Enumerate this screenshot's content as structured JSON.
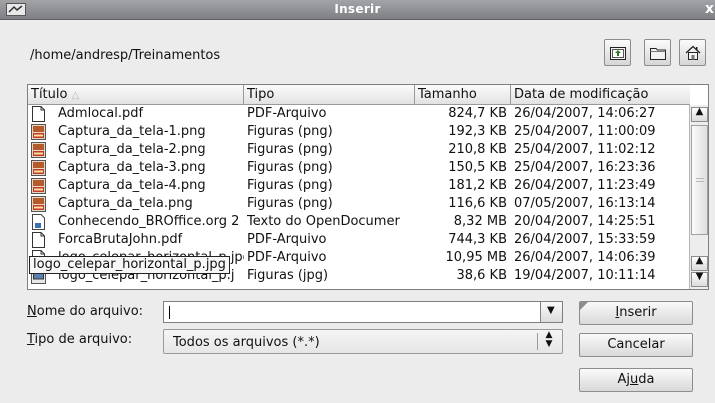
{
  "window": {
    "title": "Inserir",
    "close_glyph": "x"
  },
  "path": "/home/andresp/Treinamentos",
  "toolbar": {
    "buttons": [
      {
        "name": "level-up-button",
        "icon": "folder-up-icon"
      },
      {
        "name": "new-folder-button",
        "icon": "new-folder-icon"
      },
      {
        "name": "home-button",
        "icon": "home-icon"
      }
    ]
  },
  "table": {
    "columns": [
      {
        "label": "Título",
        "sort_indicator": "△"
      },
      {
        "label": "Tipo"
      },
      {
        "label": "Tamanho"
      },
      {
        "label": "Data de modificação"
      }
    ],
    "rows": [
      {
        "icon": "document-icon",
        "name": "Admlocal.pdf",
        "type": "PDF-Arquivo",
        "size": "824,7 KB",
        "date": "26/04/2007, 14:06:27"
      },
      {
        "icon": "png-image-icon",
        "name": "Captura_da_tela-1.png",
        "type": "Figuras (png)",
        "size": "192,3 KB",
        "date": "25/04/2007, 11:00:09"
      },
      {
        "icon": "png-image-icon",
        "name": "Captura_da_tela-2.png",
        "type": "Figuras (png)",
        "size": "210,8 KB",
        "date": "25/04/2007, 11:02:12"
      },
      {
        "icon": "png-image-icon",
        "name": "Captura_da_tela-3.png",
        "type": "Figuras (png)",
        "size": "150,5 KB",
        "date": "25/04/2007, 16:23:36"
      },
      {
        "icon": "png-image-icon",
        "name": "Captura_da_tela-4.png",
        "type": "Figuras (png)",
        "size": "181,2 KB",
        "date": "26/04/2007, 11:23:49"
      },
      {
        "icon": "png-image-icon",
        "name": "Captura_da_tela.png",
        "type": "Figuras (png)",
        "size": "116,6 KB",
        "date": "07/05/2007, 16:13:14"
      },
      {
        "icon": "odt-document-icon",
        "name": "Conhecendo_BROffice.org 2",
        "type": "Texto do OpenDocumer",
        "size": "8,32 MB",
        "date": "20/04/2007, 14:25:51"
      },
      {
        "icon": "document-icon",
        "name": "ForcaBrutaJohn.pdf",
        "type": "PDF-Arquivo",
        "size": "744,3 KB",
        "date": "26/04/2007, 15:33:59"
      },
      {
        "icon": "document-icon",
        "name": "logo_celepar_horizontal_p.jpg",
        "type": "PDF-Arquivo",
        "size": "10,95 MB",
        "date": "26/04/2007, 14:06:39"
      },
      {
        "icon": "jpg-image-icon",
        "name": "logo_celepar_horizontal_p.j",
        "type": "Figuras (jpg)",
        "size": "38,6 KB",
        "date": "19/04/2007, 10:11:14"
      }
    ]
  },
  "tooltip": "logo_celepar_horizontal_p.jpg",
  "filename": {
    "label_key": "N",
    "label_rest": "ome do arquivo:",
    "value": "",
    "placeholder": ""
  },
  "filetype": {
    "label_key": "T",
    "label_rest": "ipo de arquivo:",
    "value": "Todos os arquivos (*.*)"
  },
  "buttons": {
    "insert": {
      "pre": "",
      "key": "I",
      "post": "nserir"
    },
    "cancel": {
      "label": "Cancelar"
    },
    "help": {
      "pre": "Aj",
      "key": "u",
      "post": "da"
    }
  }
}
